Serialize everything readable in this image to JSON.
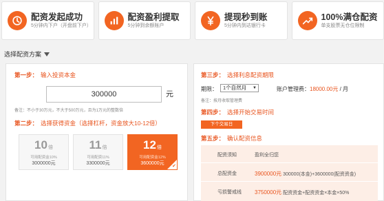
{
  "features": [
    {
      "icon": "clock-icon",
      "title": "配资发起成功",
      "sub": "5分钟内下户（开盘前下户）"
    },
    {
      "icon": "chart-bars-icon",
      "title": "配资盈利提取",
      "sub": "5分钟到余额账户"
    },
    {
      "icon": "yen-coin-icon",
      "title": "提现秒到账",
      "sub": "5分钟内到达银行卡"
    },
    {
      "icon": "trend-up-icon",
      "title": "100%满仓配资",
      "sub": "单支股票无仓位限制"
    }
  ],
  "section_label": "选择配资方案",
  "left": {
    "step1_label": "第一步：",
    "step1_text": "输入投资本金",
    "amount": "300000",
    "unit": "元",
    "note": "备注：不小于30万元，不大于500万元，且为1万元的整数倍",
    "step2_label": "第二步：",
    "step2_text": "选择获得资金（选择杠杆，资金放大10-12倍）",
    "levels": [
      {
        "num": "10",
        "unit": "倍",
        "line1": "可用配资金10%",
        "line2": "3000000元",
        "selected": false
      },
      {
        "num": "11",
        "unit": "倍",
        "line1": "可用配资11%",
        "line2": "3300000元",
        "selected": false
      },
      {
        "num": "12",
        "unit": "倍",
        "line1": "可用配资金12%",
        "line2": "3600000元",
        "selected": true
      }
    ],
    "check_glyph": "✔"
  },
  "right": {
    "step3_label": "第三步：",
    "step3_text": "选择利息配资期限",
    "period_label": "期限：",
    "period_value": "1个自然月",
    "period_arrow": "▼",
    "fee_label": "账户管理费：",
    "fee_value": "18000.00元",
    "fee_unit": " / 月",
    "period_note": "备注：按月收取管理费",
    "step4_label": "第四步：",
    "step4_text": "选择开始交易时间",
    "date_button": "下个交易日",
    "step5_label": "第五步：",
    "step5_text": "确认配资信息",
    "table": [
      {
        "key": "配资须知",
        "val_orange": "",
        "val": "盈利全归您"
      },
      {
        "key": "总配资金",
        "val_orange": "3900000元",
        "val": "300000(本金)+3600000(配资资金)"
      },
      {
        "key": "亏损警戒线",
        "val_orange": "3750000元",
        "val": "配资资金+配资资金×本金×50%"
      }
    ]
  },
  "colors": {
    "accent": "#f26522",
    "accent_text": "#e8541e",
    "bg": "#f2f2f2"
  }
}
